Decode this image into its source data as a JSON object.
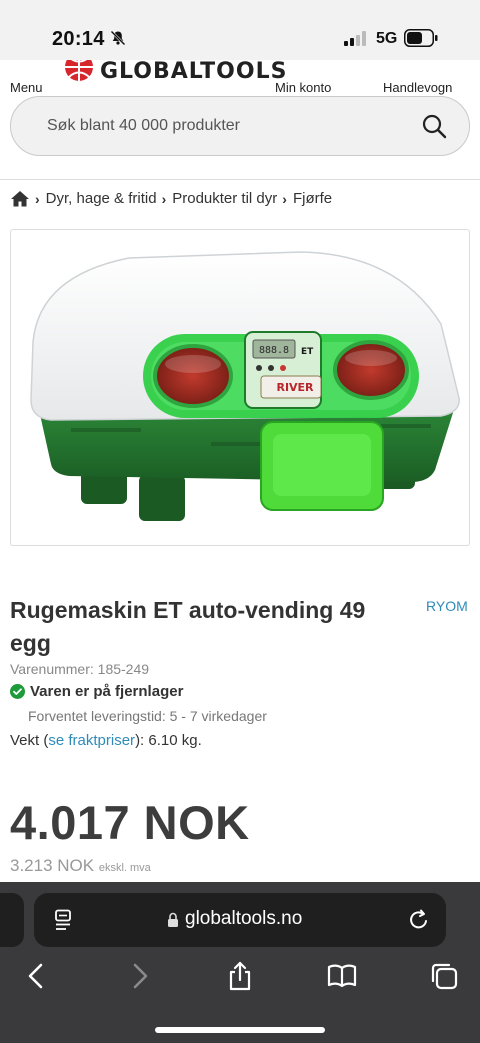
{
  "status_bar": {
    "time": "20:14",
    "network": "5G"
  },
  "header": {
    "logo_text": "GLOBALTOOLS",
    "menu_label": "Menu",
    "account_label": "Min konto",
    "cart_label": "Handlevogn",
    "search": {
      "placeholder": "Søk blant 40 000 produkter"
    }
  },
  "breadcrumb": [
    "Dyr, hage & fritid",
    "Produkter til dyr",
    "Fjørfe"
  ],
  "product": {
    "title": "Rugemaskin ET auto-vending 49 egg",
    "brand": "RYOM",
    "sku": "Varenummer: 185-249",
    "stock_status": "Varen er på fjernlager",
    "delivery": "Forventet leveringstid: 5 - 7 virkedager",
    "weight_prefix": "Vekt (",
    "weight_link": "se fraktpriser",
    "weight_suffix": "): 6.10 kg.",
    "price": "4.017 NOK",
    "price_ex_vat": "3.213 NOK",
    "price_ex_vat_note": "ekskl. mva",
    "image": {
      "display_brand": "RIVER",
      "display_model": "ET",
      "display_readout": "888.8"
    }
  },
  "browser": {
    "url": "globaltools.no"
  },
  "colors": {
    "accent": "#2e8bb8",
    "price": "#3d3d3d",
    "success": "#1d9b3a",
    "incubator_green": "#27c43a"
  }
}
